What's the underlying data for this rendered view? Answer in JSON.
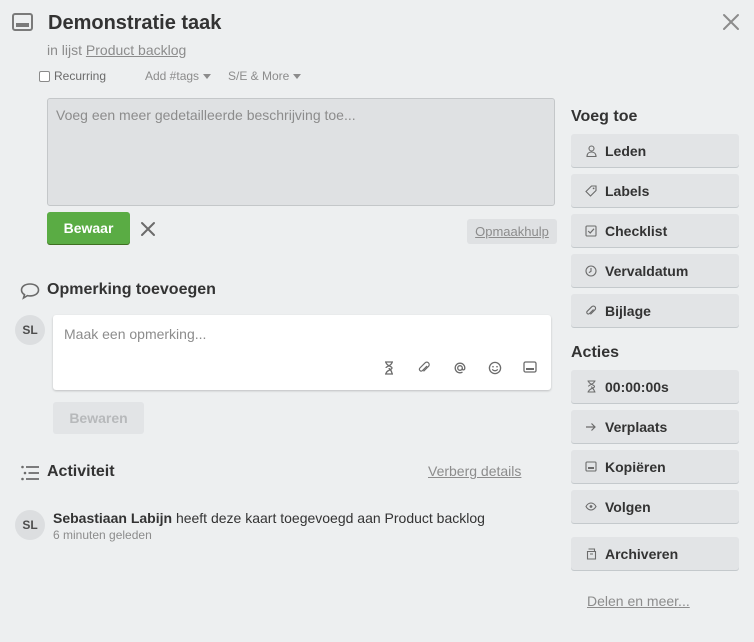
{
  "card": {
    "title": "Demonstratie taak",
    "list_prefix": "in lijst",
    "list_name": "Product backlog"
  },
  "options": {
    "recurring_label": "Recurring",
    "recurring_checked": false,
    "tags_label": "Add #tags",
    "more_label": "S/E & More"
  },
  "description": {
    "placeholder": "Voeg een meer gedetailleerde beschrijving toe...",
    "save_label": "Bewaar",
    "format_help_label": "Opmaakhulp"
  },
  "comment": {
    "section_title": "Opmerking toevoegen",
    "avatar_initials": "SL",
    "placeholder": "Maak een opmerking...",
    "save_label": "Bewaren"
  },
  "activity": {
    "section_title": "Activiteit",
    "toggle_details_label": "Verberg details",
    "entries": [
      {
        "initials": "SL",
        "user": "Sebastiaan Labijn",
        "text": "heeft deze kaart toegevoegd aan Product backlog",
        "time": "6 minuten geleden"
      }
    ]
  },
  "sidebar": {
    "add_title": "Voeg toe",
    "add_buttons": [
      {
        "label": "Leden",
        "icon": "person-icon"
      },
      {
        "label": "Labels",
        "icon": "label-icon"
      },
      {
        "label": "Checklist",
        "icon": "checkbox-icon"
      },
      {
        "label": "Vervaldatum",
        "icon": "clock-icon"
      },
      {
        "label": "Bijlage",
        "icon": "paperclip-icon"
      }
    ],
    "actions_title": "Acties",
    "action_buttons": [
      {
        "label": "00:00:00s",
        "icon": "hourglass-icon"
      },
      {
        "label": "Verplaats",
        "icon": "arrow-right-icon"
      },
      {
        "label": "Kopiëren",
        "icon": "card-icon"
      },
      {
        "label": "Volgen",
        "icon": "eye-icon"
      },
      {
        "label": "Archiveren",
        "icon": "archive-icon"
      }
    ],
    "share_label": "Delen en meer..."
  },
  "colors": {
    "save_green": "#5aac44",
    "background": "#edeff0",
    "button_gray": "#e2e4e6"
  }
}
